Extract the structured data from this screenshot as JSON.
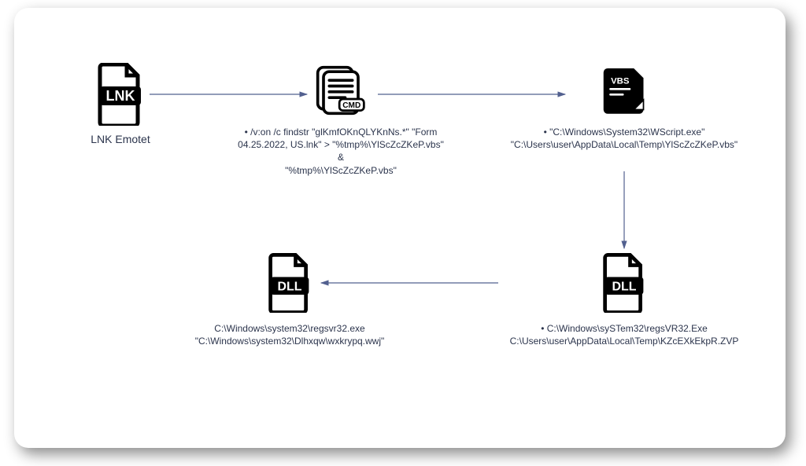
{
  "nodes": {
    "lnk": {
      "badge": "LNK",
      "caption": "LNK Emotet"
    },
    "cmd": {
      "badge": "CMD",
      "caption": "• /v:on /c findstr \"glKmfOKnQLYKnNs.*\" \"Form\n04.25.2022, US.lnk\" > \"%tmp%\\YlScZcZKeP.vbs\" &\n\"%tmp%\\YlScZcZKeP.vbs\""
    },
    "vbs": {
      "badge": "VBS",
      "caption": "• \"C:\\Windows\\System32\\WScript.exe\"\n\"C:\\Users\\user\\AppData\\Local\\Temp\\YlScZcZKeP.vbs\""
    },
    "dll1": {
      "badge": "DLL",
      "caption": "• C:\\Windows\\sySTem32\\regsVR32.Exe\nC:\\Users\\user\\AppData\\Local\\Temp\\KZcEXkEkpR.ZVP"
    },
    "dll2": {
      "badge": "DLL",
      "caption": "C:\\Windows\\system32\\regsvr32.exe\n\"C:\\Windows\\system32\\Dlhxqw\\wxkrypq.wwj\""
    }
  }
}
